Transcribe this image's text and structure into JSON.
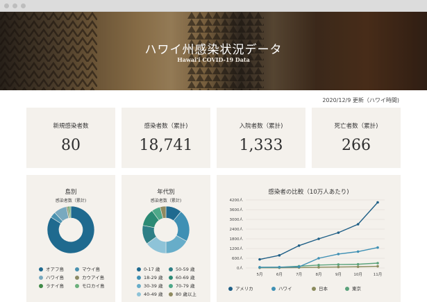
{
  "hero": {
    "title": "ハワイ州感染状況データ",
    "subtitle": "Hawai'i COVID-19 Data"
  },
  "updated": "2020/12/9 更新（ハワイ時間)",
  "stats": [
    {
      "label": "新規感染者数",
      "value": "80"
    },
    {
      "label": "感染者数（累計)",
      "value": "18,741"
    },
    {
      "label": "入院者数（累計)",
      "value": "1,333"
    },
    {
      "label": "死亡者数（累計)",
      "value": "266"
    }
  ],
  "colors": {
    "card_bg": "#f4f1ec",
    "america": "#1f5f86",
    "hawaii": "#3f90b4",
    "japan": "#8a8a5c",
    "tokyo": "#5aa27b"
  },
  "island_chart": {
    "title": "島別",
    "subtitle": "感染者数（累計)",
    "legend": [
      {
        "name": "オアフ島",
        "color": "#1f6a8f"
      },
      {
        "name": "マウイ島",
        "color": "#4a92b0"
      },
      {
        "name": "ハワイ島",
        "color": "#78a9bf"
      },
      {
        "name": "カウアイ島",
        "color": "#8b8a66"
      },
      {
        "name": "ラナイ島",
        "color": "#3f8a47"
      },
      {
        "name": "モロカイ島",
        "color": "#6bb07c"
      }
    ]
  },
  "age_chart": {
    "title": "年代別",
    "subtitle": "感染者数（累計)",
    "legend": [
      {
        "name": "0-17 歳",
        "color": "#1f6a8f"
      },
      {
        "name": "50-59 歳",
        "color": "#2e7f86"
      },
      {
        "name": "18-29 歳",
        "color": "#3f90b4"
      },
      {
        "name": "60-69 歳",
        "color": "#2c8a74"
      },
      {
        "name": "30-39 歳",
        "color": "#67adc9"
      },
      {
        "name": "70-79 歳",
        "color": "#4ea889"
      },
      {
        "name": "40-49 歳",
        "color": "#8ec3d8"
      },
      {
        "name": "80 歳以上",
        "color": "#8f8a60"
      }
    ]
  },
  "chart_data": [
    {
      "type": "pie",
      "title": "島別",
      "subtitle": "感染者数（累計)",
      "categories": [
        "オアフ島",
        "マウイ島",
        "ハワイ島",
        "カウアイ島",
        "ラナイ島",
        "モロカイ島"
      ],
      "values": [
        84,
        4,
        9,
        1,
        1,
        1
      ],
      "donut": true,
      "legend_position": "bottom"
    },
    {
      "type": "pie",
      "title": "年代別",
      "subtitle": "感染者数（累計)",
      "categories": [
        "0-17 歳",
        "18-29 歳",
        "30-39 歳",
        "40-49 歳",
        "50-59 歳",
        "60-69 歳",
        "70-79 歳",
        "80 歳以上"
      ],
      "values": [
        11,
        22,
        17,
        15,
        13,
        12,
        6,
        4
      ],
      "donut": true,
      "legend_position": "bottom"
    },
    {
      "type": "line",
      "title": "感染者の比較（10万人あたり)",
      "x": [
        "5月",
        "6月",
        "7月",
        "8月",
        "9月",
        "10月",
        "11月"
      ],
      "yticks": [
        "0人",
        "600人",
        "1200人",
        "1800人",
        "2400人",
        "3000人",
        "3600人",
        "4200人"
      ],
      "ylim": [
        0,
        4200
      ],
      "grid": true,
      "legend_position": "bottom",
      "series": [
        {
          "name": "アメリカ",
          "values": [
            530,
            780,
            1380,
            1800,
            2180,
            2700,
            4050
          ]
        },
        {
          "name": "ハワイ",
          "values": [
            45,
            50,
            70,
            600,
            860,
            1010,
            1260
          ]
        },
        {
          "name": "日本",
          "values": [
            13,
            14,
            25,
            45,
            60,
            75,
            105
          ]
        },
        {
          "name": "東京",
          "values": [
            35,
            45,
            110,
            180,
            210,
            230,
            300
          ]
        }
      ]
    }
  ]
}
